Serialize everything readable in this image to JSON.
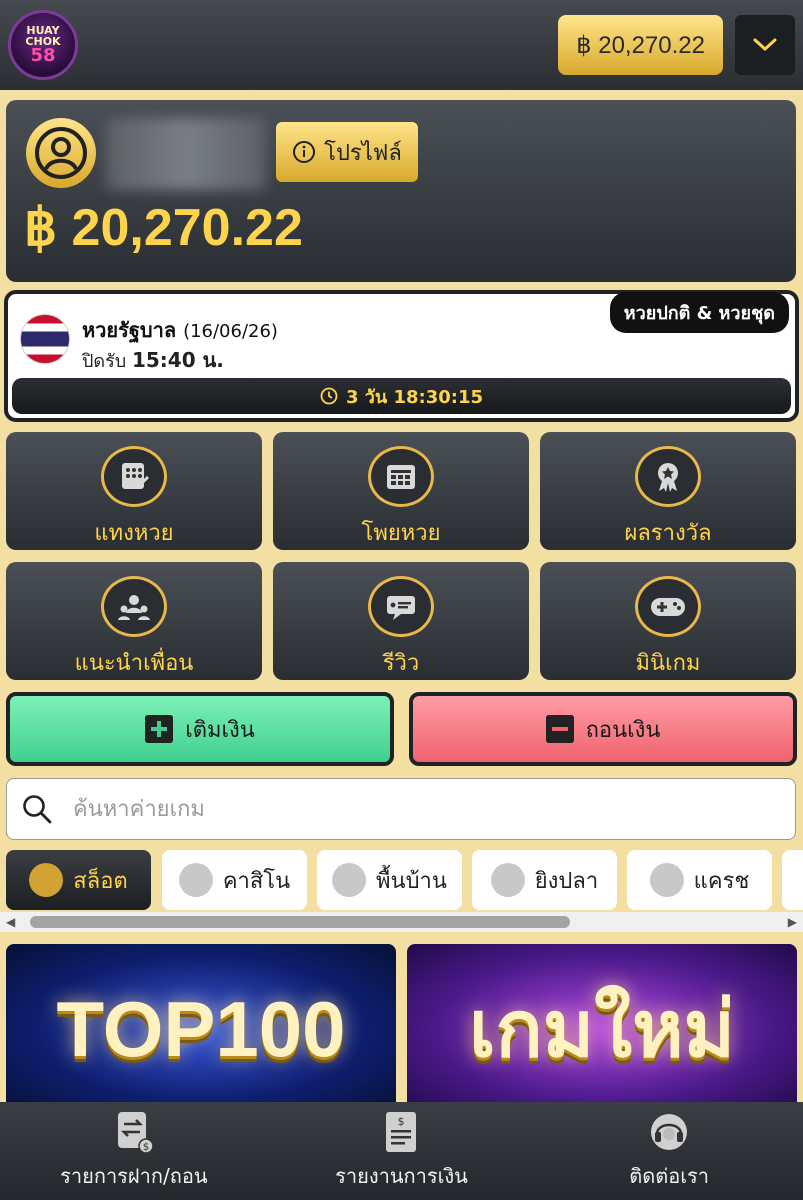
{
  "header": {
    "logo_line1": "HUAY",
    "logo_line2": "CHOK",
    "logo_line3": "58",
    "balance": "฿ 20,270.22"
  },
  "profile": {
    "button_label": "โปรไฟล์",
    "balance": "฿ 20,270.22"
  },
  "lottery": {
    "tag": "หวยปกติ & หวยชุด",
    "title": "หวยรัฐบาล",
    "date": "(16/06/26)",
    "close_prefix": "ปิดรับ",
    "close_time": "15:40 น.",
    "countdown": "3 วัน 18:30:15"
  },
  "tiles": [
    {
      "label": "แทงหวย",
      "icon": "bet-icon"
    },
    {
      "label": "โพยหวย",
      "icon": "ticket-list-icon"
    },
    {
      "label": "ผลรางวัล",
      "icon": "award-icon"
    },
    {
      "label": "แนะนำเพื่อน",
      "icon": "referral-icon"
    },
    {
      "label": "รีวิว",
      "icon": "review-icon"
    },
    {
      "label": "มินิเกม",
      "icon": "gamepad-icon"
    }
  ],
  "cash": {
    "deposit": "เติมเงิน",
    "withdraw": "ถอนเงิน"
  },
  "search": {
    "placeholder": "ค้นหาค่ายเกม"
  },
  "categories": [
    {
      "label": "สล็อต",
      "active": true
    },
    {
      "label": "คาสิโน",
      "active": false
    },
    {
      "label": "พื้นบ้าน",
      "active": false
    },
    {
      "label": "ยิงปลา",
      "active": false
    },
    {
      "label": "แครช",
      "active": false
    }
  ],
  "banners": {
    "top": "TOP100",
    "new": "เกมใหม่"
  },
  "bottom_nav": [
    {
      "label": "รายการฝาก/ถอน"
    },
    {
      "label": "รายงานการเงิน"
    },
    {
      "label": "ติดต่อเรา"
    }
  ],
  "colors": {
    "gold": "#ffd44d",
    "background": "#f3dfa2",
    "dark_card": "#2a2e32",
    "deposit_green": "#3fd08e",
    "withdraw_red": "#f0626d"
  }
}
